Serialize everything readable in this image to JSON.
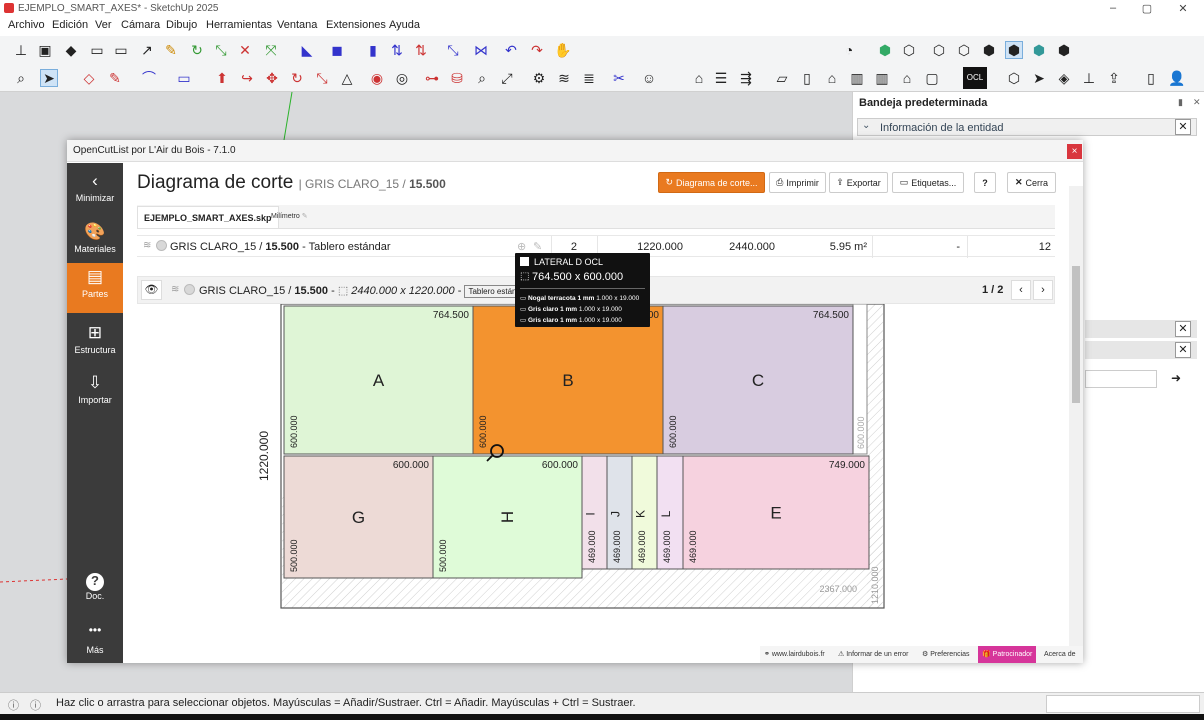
{
  "app": {
    "window_title": "EJEMPLO_SMART_AXES* - SketchUp 2025"
  },
  "window_controls": {
    "minimize": "–",
    "maximize": "▢",
    "close": "✕"
  },
  "menu": [
    "Archivo",
    "Edición",
    "Ver",
    "Cámara",
    "Dibujo",
    "Herramientas",
    "Ventana",
    "Extensiones",
    "Ayuda"
  ],
  "tray": {
    "title": "Bandeja predeterminada",
    "section": "Información de la entidad",
    "close": "✕"
  },
  "status": {
    "text": "Haz clic o arrastra para seleccionar objetos. Mayúsculas = Añadir/Sustraer. Ctrl = Añadir. Mayúsculas + Ctrl = Sustraer."
  },
  "dialog": {
    "title": "OpenCutList por L'Air du Bois - 7.1.0",
    "close": "×",
    "sidebar": [
      {
        "label": "Minimizar",
        "icon": "‹"
      },
      {
        "label": "Materiales",
        "icon": "🎨"
      },
      {
        "label": "Partes",
        "icon": "▤"
      },
      {
        "label": "Estructura",
        "icon": "⊞"
      },
      {
        "label": "Importar",
        "icon": "⇩"
      },
      {
        "label": "Doc.",
        "icon": "?"
      },
      {
        "label": "Más",
        "icon": "•••"
      }
    ],
    "heading": "Diagrama de corte",
    "heading_sub_prefix": "| GRIS CLARO_15 / ",
    "heading_sub_bold": "15.500",
    "buttons": {
      "cut": "Diagrama de corte...",
      "print": "Imprimir",
      "export": "Exportar",
      "labels": "Etiquetas...",
      "help": "?",
      "close": "Cerra"
    },
    "tabs": {
      "file": "EJEMPLO_SMART_AXES.skp",
      "unit": "Milímetro"
    },
    "row": {
      "name_prefix": "GRIS CLARO_15 / ",
      "name_bold": "15.500",
      "name_suffix": " - Tablero estándar",
      "count": "2",
      "length": "1220.000",
      "width": "2440.000",
      "area": "5.95 m²",
      "dash": "-",
      "total": "12"
    },
    "panel": {
      "name_prefix": "GRIS CLARO_15 / ",
      "name_bold": "15.500",
      "dims": "2440.000 x 1220.000",
      "sep": " - ",
      "badge": "Tablero estándar",
      "page": "1 / 2"
    },
    "footer": {
      "site": "www.lairdubois.fr",
      "report": "Informar de un error",
      "prefs": "Preferencias",
      "sponsor": "Patrocinador",
      "about": "Acerca de"
    }
  },
  "tooltip": {
    "name": "LATERAL D OCL",
    "size": "764.500 x 600.000",
    "edges": [
      {
        "label": "Nogal terracota 1 mm",
        "dims": "1.000 x 19.000"
      },
      {
        "label": "Gris claro 1 mm",
        "dims": "1.000 x 19.000"
      },
      {
        "label": "Gris claro 1 mm",
        "dims": "1.000 x 19.000"
      }
    ]
  },
  "sheet": {
    "height_label": "1220.000",
    "offcut_width": "2367.000",
    "offcut_height": "1210.000",
    "right_strip": "600.000",
    "parts": [
      {
        "id": "A",
        "w": "764.500",
        "h": "600.000",
        "color": "#dff5d6"
      },
      {
        "id": "B",
        "w": "764.500",
        "h": "600.000",
        "color": "#f3932f"
      },
      {
        "id": "C",
        "w": "764.500",
        "h": "600.000",
        "color": "#d8cce0"
      },
      {
        "id": "G",
        "w": "600.000",
        "h": "500.000",
        "color": "#eddad6"
      },
      {
        "id": "H",
        "w": "600.000",
        "h": "500.000",
        "color": "#dffbd8"
      },
      {
        "id": "I",
        "w": "",
        "h": "469.000",
        "color": "#f2e0ea"
      },
      {
        "id": "J",
        "w": "",
        "h": "469.000",
        "color": "#dfe3ea"
      },
      {
        "id": "K",
        "w": "",
        "h": "469.000",
        "color": "#f0fadb"
      },
      {
        "id": "L",
        "w": "",
        "h": "469.000",
        "color": "#f2e0f2"
      },
      {
        "id": "E",
        "w": "749.000",
        "h": "469.000",
        "color": "#f6d2df"
      }
    ]
  }
}
